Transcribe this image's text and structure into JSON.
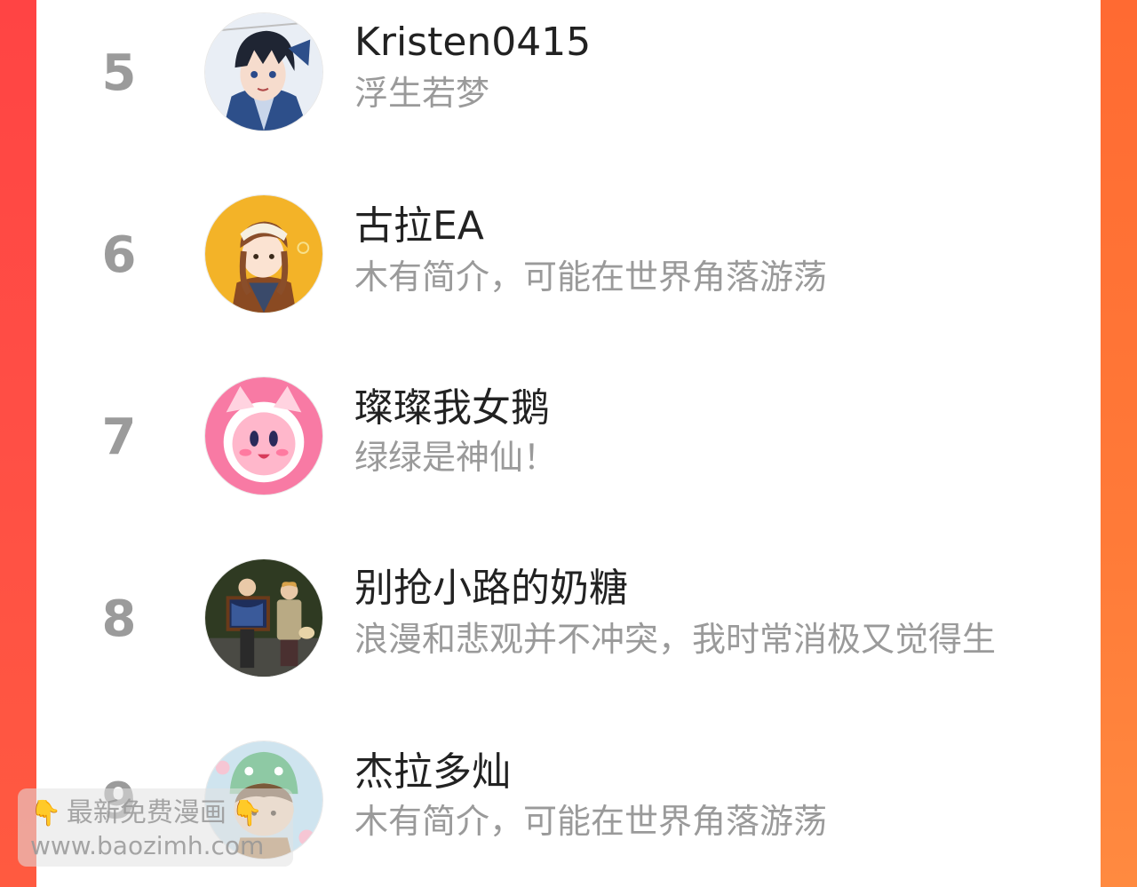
{
  "ranking": [
    {
      "rank": "5",
      "name": "Kristen0415",
      "bio": "浮生若梦",
      "avatar_icon": "anime-boy-avatar-icon"
    },
    {
      "rank": "6",
      "name": "古拉EA",
      "bio": "木有简介，可能在世界角落游荡",
      "avatar_icon": "anime-girl-yellow-avatar-icon"
    },
    {
      "rank": "7",
      "name": "璨璨我女鹅",
      "bio": "绿绿是神仙！",
      "avatar_icon": "pink-kirby-avatar-icon"
    },
    {
      "rank": "8",
      "name": "别抢小路的奶糖",
      "bio": "浪漫和悲观并不冲突，我时常消极又觉得生",
      "avatar_icon": "two-children-photo-avatar-icon"
    },
    {
      "rank": "9",
      "name": "杰拉多灿",
      "bio": "木有简介，可能在世界角落游荡",
      "avatar_icon": "cartoon-kid-avatar-icon"
    }
  ],
  "watermark": {
    "line1": "最新免费漫画",
    "line2": "www.baozimh.com",
    "hand_icon": "pointing-down-hand-icon"
  },
  "colors": {
    "frame_left": "#ff4d4d",
    "frame_right": "#ff7a38",
    "rank_number": "#9b9b9b",
    "name_text": "#222222",
    "bio_text": "#9a9a9a"
  }
}
